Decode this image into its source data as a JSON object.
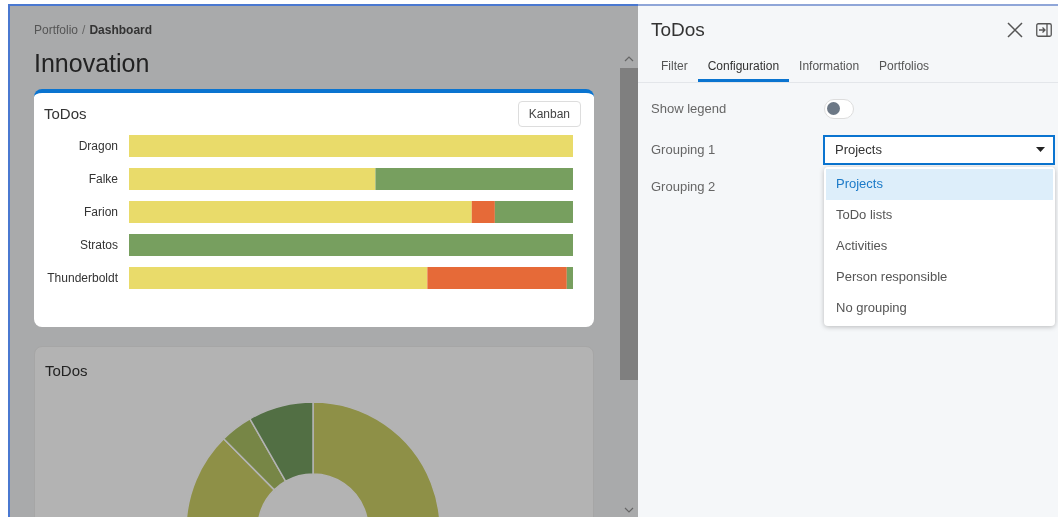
{
  "breadcrumb": {
    "parent": "Portfolio",
    "separator": "/",
    "current": "Dashboard"
  },
  "page_title": "Innovation",
  "bar_card": {
    "title": "ToDos",
    "button": "Kanban",
    "rows": [
      {
        "label": "Dragon"
      },
      {
        "label": "Falke"
      },
      {
        "label": "Farion"
      },
      {
        "label": "Stratos"
      },
      {
        "label": "Thunderboldt"
      }
    ]
  },
  "donut_card": {
    "title": "ToDos"
  },
  "panel": {
    "title": "ToDos",
    "tabs": [
      {
        "label": "Filter",
        "selected": false
      },
      {
        "label": "Configuration",
        "selected": true
      },
      {
        "label": "Information",
        "selected": false
      },
      {
        "label": "Portfolios",
        "selected": false
      }
    ],
    "show_legend": {
      "label": "Show legend",
      "on": false
    },
    "grouping_1": {
      "label": "Grouping 1",
      "value": "Projects",
      "expanded": true
    },
    "grouping_2": {
      "label": "Grouping 2"
    },
    "options": [
      {
        "label": "Projects",
        "selected": true
      },
      {
        "label": "ToDo lists",
        "selected": false
      },
      {
        "label": "Activities",
        "selected": false
      },
      {
        "label": "Person responsible",
        "selected": false
      },
      {
        "label": "No grouping",
        "selected": false
      }
    ]
  }
}
